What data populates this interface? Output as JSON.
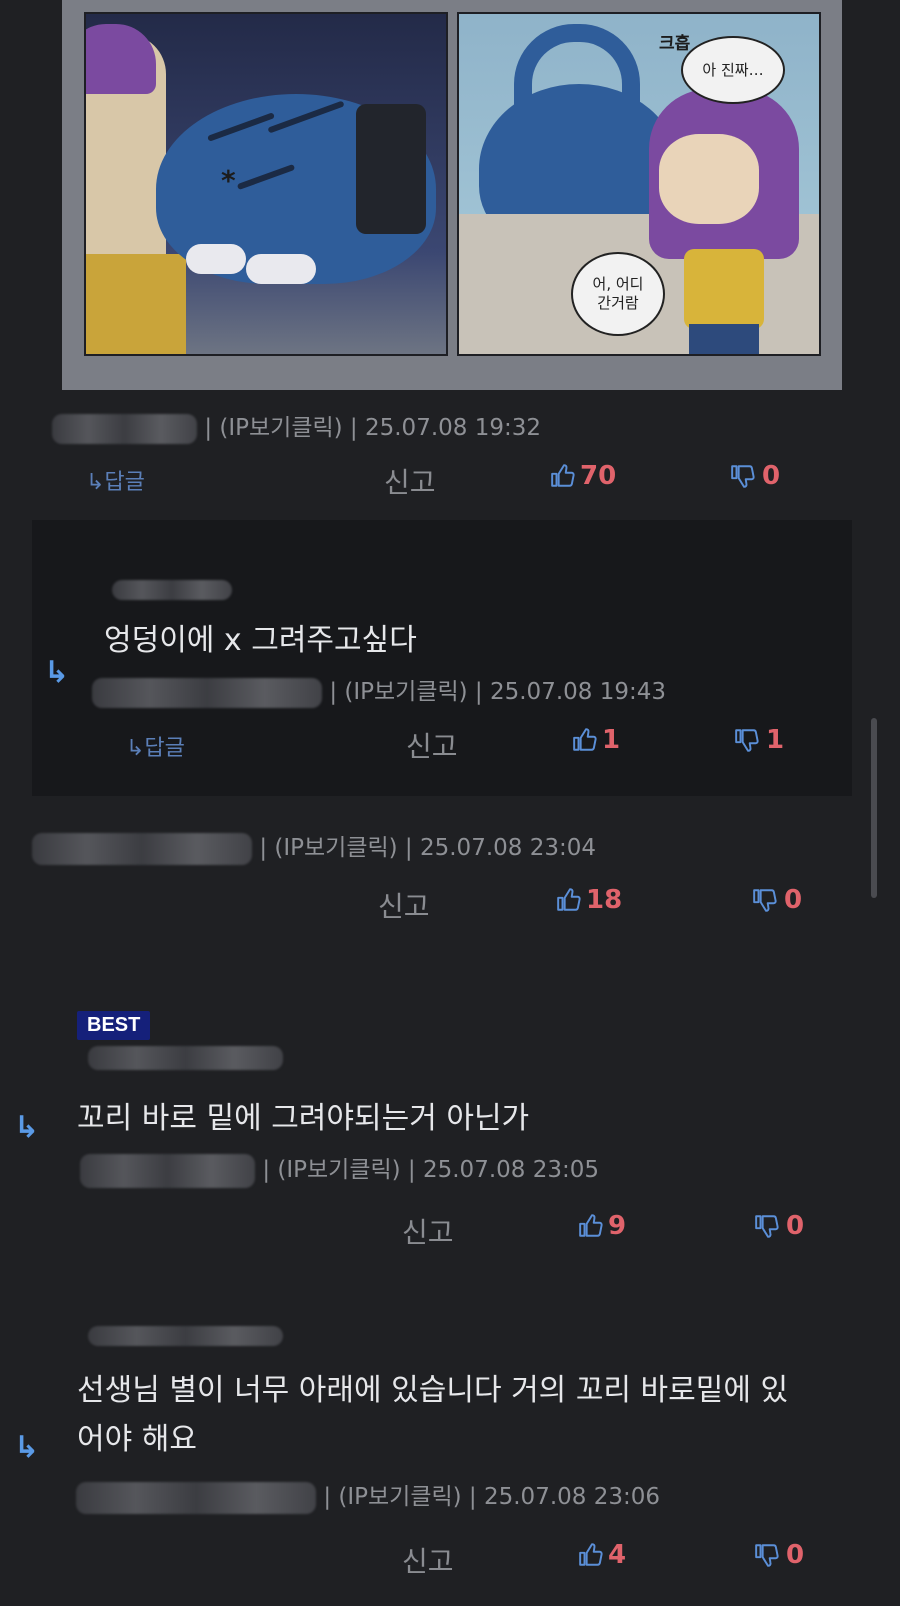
{
  "comic": {
    "bubble_right_top": "아 진짜…",
    "sfx_top": "크흡",
    "bubble_right_bottom": "어, 어디\n간거람",
    "star_mark": "*"
  },
  "comments": [
    {
      "meta": "| (IP보기클릭) | 25.07.08 19:32",
      "reply_label": "↳답글",
      "report_label": "신고",
      "likes": "70",
      "dislikes": "0"
    },
    {
      "content": "엉덩이에 x 그려주고싶다",
      "meta": "| (IP보기클릭) | 25.07.08 19:43",
      "reply_label": "↳답글",
      "report_label": "신고",
      "likes": "1",
      "dislikes": "1"
    },
    {
      "meta": "| (IP보기클릭) | 25.07.08 23:04",
      "report_label": "신고",
      "likes": "18",
      "dislikes": "0"
    },
    {
      "badge": "BEST",
      "content": "꼬리 바로 밑에 그려야되는거 아닌가",
      "meta": "| (IP보기클릭) | 25.07.08 23:05",
      "report_label": "신고",
      "likes": "9",
      "dislikes": "0"
    },
    {
      "content_line1": "선생님 별이 너무 아래에 있습니다 거의 꼬리 바로밑에 있",
      "content_line2": "어야 해요",
      "meta": "| (IP보기클릭) | 25.07.08 23:06",
      "report_label": "신고",
      "likes": "4",
      "dislikes": "0"
    }
  ],
  "colors": {
    "background": "#1f2023",
    "reply_background": "#17181b",
    "count_red": "#e0636b",
    "thumb_blue": "#5b8fd8",
    "best_badge": "#15207a"
  },
  "icons": [
    "thumbs-up-icon",
    "thumbs-down-icon",
    "reply-arrow-icon"
  ]
}
